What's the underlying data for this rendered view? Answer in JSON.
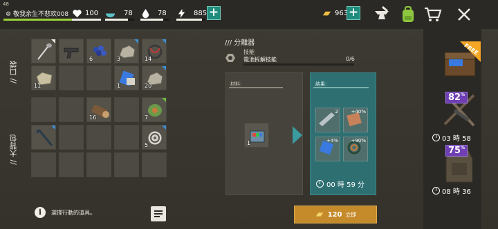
{
  "player": {
    "level": "48",
    "name": "敬我余生不悲欢008"
  },
  "stats": {
    "health": "100",
    "food": "78",
    "water": "78",
    "energy": "885",
    "gold": "963",
    "xp_progress": 0.95,
    "health_progress": 1.0,
    "food_progress": 0.78,
    "water_progress": 0.78,
    "energy_progress": 0.88
  },
  "top_icons": [
    "anvil-icon",
    "backpack-icon",
    "cart-icon",
    "close-icon"
  ],
  "inventory": {
    "pocket_label": "口袋",
    "bag_label": "大背包",
    "pocket_slots": [
      {
        "item": "shovel",
        "count": "",
        "corner": "white"
      },
      {
        "item": "pistol",
        "count": "",
        "corner": ""
      },
      {
        "item": "berries",
        "count": "6",
        "corner": ""
      },
      {
        "item": "stone",
        "count": "3",
        "corner": "blue"
      },
      {
        "item": "wire",
        "count": "14",
        "corner": "blue"
      },
      {
        "item": "fabric",
        "count": "11",
        "corner": ""
      },
      {
        "item": "empty",
        "count": "",
        "corner": ""
      },
      {
        "item": "empty",
        "count": "",
        "corner": ""
      },
      {
        "item": "blue-part",
        "count": "1",
        "corner": ""
      },
      {
        "item": "stone",
        "count": "20",
        "corner": "blue"
      }
    ],
    "bag_slots": [
      {
        "item": "empty",
        "count": "",
        "corner": ""
      },
      {
        "item": "empty",
        "count": "",
        "corner": ""
      },
      {
        "item": "log",
        "count": "16",
        "corner": ""
      },
      {
        "item": "empty",
        "count": "",
        "corner": ""
      },
      {
        "item": "wire-spool",
        "count": "7",
        "corner": "green"
      },
      {
        "item": "crowbar",
        "count": "",
        "corner": "blue"
      },
      {
        "item": "empty",
        "count": "",
        "corner": ""
      },
      {
        "item": "empty",
        "count": "",
        "corner": ""
      },
      {
        "item": "empty",
        "count": "",
        "corner": ""
      },
      {
        "item": "wire-reel",
        "count": "5",
        "corner": "blue"
      },
      {
        "item": "empty",
        "count": "",
        "corner": ""
      },
      {
        "item": "empty",
        "count": "",
        "corner": ""
      },
      {
        "item": "empty",
        "count": "",
        "corner": ""
      },
      {
        "item": "empty",
        "count": "",
        "corner": ""
      },
      {
        "item": "empty",
        "count": "",
        "corner": ""
      }
    ]
  },
  "disassembler": {
    "title": "分離器",
    "skill_label": "技能",
    "skill_name": "電池拆解技能",
    "skill_value": "0/6",
    "materials_label": "材料:",
    "results_label": "結果:",
    "input_count": "1",
    "results": [
      {
        "count": "2",
        "pct": ""
      },
      {
        "count": "",
        "pct": "+40%"
      },
      {
        "count": "",
        "pct": "+4%"
      },
      {
        "count": "",
        "pct": "+90%"
      }
    ],
    "timer": "00 時 59 分",
    "buy_price": "120",
    "buy_label": "立即"
  },
  "hint": {
    "text": "選擇行動的道具。"
  },
  "promos": [
    {
      "badge": "FREE",
      "pct": "",
      "time": ""
    },
    {
      "badge": "",
      "pct": "82",
      "pct_suffix": "%",
      "time": "03 時 58"
    },
    {
      "badge": "",
      "pct": "75",
      "pct_suffix": "%",
      "time": "08 時 36"
    }
  ]
}
